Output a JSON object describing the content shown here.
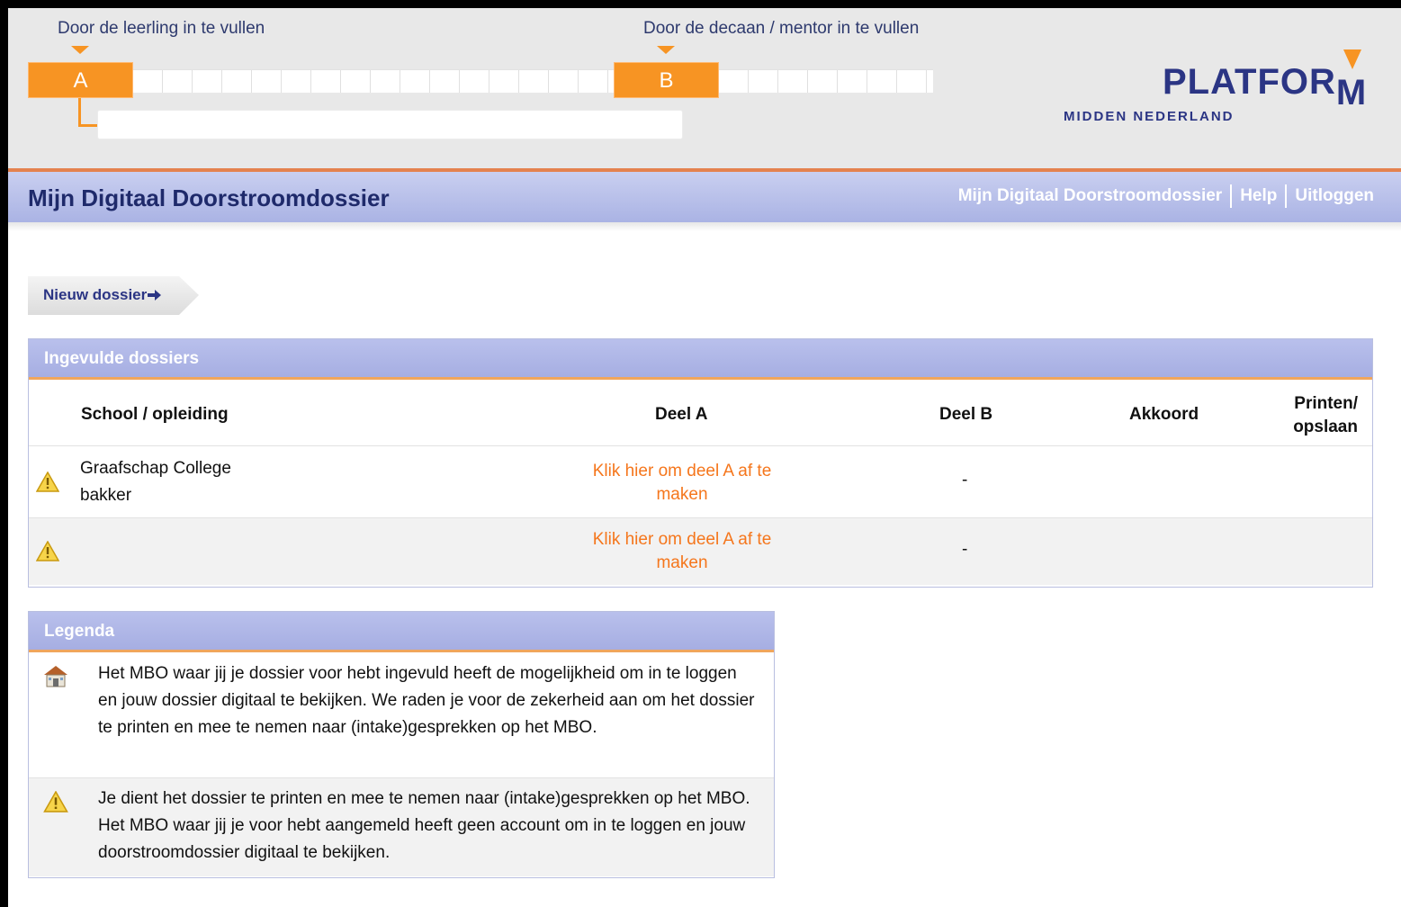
{
  "header": {
    "step_a_label": "Door de leerling in te vullen",
    "step_b_label": "Door de decaan / mentor in te vullen",
    "step_a_letter": "A",
    "step_b_letter": "B",
    "logo_main": "PLATFOR",
    "logo_m": "M",
    "logo_sub": "MIDDEN NEDERLAND",
    "colors": {
      "accent": "#f79423",
      "brand": "#2b3584",
      "header_bg": "#e8e8e8"
    }
  },
  "titlebar": {
    "title": "Mijn Digitaal Doorstroomdossier",
    "links": [
      "Mijn Digitaal Doorstroomdossier",
      "Help",
      "Uitloggen"
    ]
  },
  "new_dossier_button": "Nieuw dossier",
  "dossiers": {
    "heading": "Ingevulde dossiers",
    "columns": {
      "school": "School / opleiding",
      "deel_a": "Deel A",
      "deel_b": "Deel B",
      "akkoord": "Akkoord",
      "printen": "Printen/ opslaan"
    },
    "rows": [
      {
        "icon": "warning-icon",
        "school": "Graafschap College",
        "study": "bakker",
        "deel_a_link": "Klik hier om deel A af te maken",
        "deel_b": "-"
      },
      {
        "icon": "warning-icon",
        "school": "",
        "study": "",
        "deel_a_link": "Klik hier om deel A af te maken",
        "deel_b": "-"
      }
    ]
  },
  "legend": {
    "heading": "Legenda",
    "items": [
      {
        "icon": "school-building-icon",
        "text": "Het MBO waar jij je dossier voor hebt ingevuld heeft de mogelijkheid om in te loggen en jouw dossier digitaal te bekijken. We raden je voor de zekerheid aan om het dossier te printen en mee te nemen naar (intake)gesprekken op het MBO."
      },
      {
        "icon": "warning-icon",
        "text": "Je dient het dossier te printen en mee te nemen naar (intake)gesprekken op het MBO. Het MBO waar jij je voor hebt aangemeld heeft geen account om in te loggen en jouw doorstroomdossier digitaal te bekijken."
      }
    ]
  }
}
